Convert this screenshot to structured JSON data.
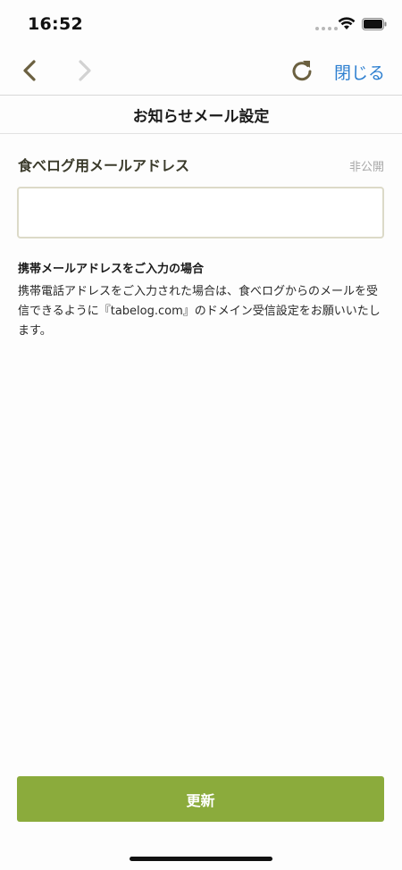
{
  "status_bar": {
    "time": "16:52"
  },
  "nav": {
    "back_icon": "chevron-left-icon",
    "forward_icon": "chevron-right-icon",
    "reload_icon": "reload-icon",
    "close_label": "閉じる",
    "close_color": "#2d7fd0"
  },
  "page": {
    "title": "お知らせメール設定"
  },
  "form": {
    "email_label": "食べログ用メールアドレス",
    "email_visibility": "非公開",
    "email_value": "",
    "mobile_heading": "携帯メールアドレスをご入力の場合",
    "mobile_notice": "携帯電話アドレスをご入力された場合は、食べログからのメールを受信できるように『tabelog.com』のドメイン受信設定をお願いいたします。"
  },
  "actions": {
    "update_label": "更新",
    "update_color": "#8bab3c"
  }
}
